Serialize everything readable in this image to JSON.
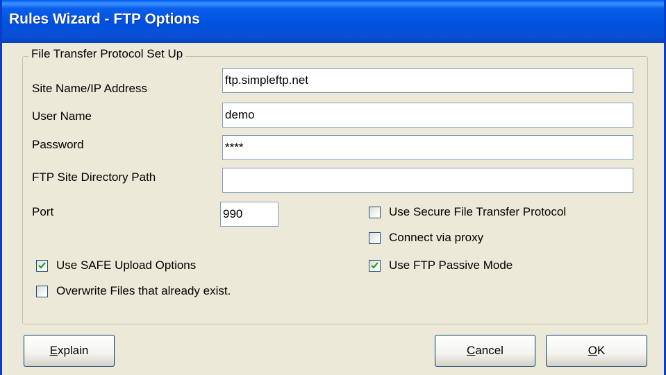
{
  "window": {
    "title": "Rules Wizard - FTP Options"
  },
  "group": {
    "legend": "File Transfer Protocol Set Up"
  },
  "fields": {
    "site_label": "Site Name/IP Address",
    "site_value": "ftp.simpleftp.net",
    "user_label": "User Name",
    "user_value": "demo",
    "password_label": "Password",
    "password_value": "****",
    "path_label": "FTP Site Directory Path",
    "path_value": "",
    "port_label": "Port",
    "port_value": "990"
  },
  "checkboxes": {
    "secure": {
      "label": "Use Secure File Transfer Protocol",
      "checked": false
    },
    "proxy": {
      "label": "Connect via proxy",
      "checked": false
    },
    "safe_upload": {
      "label": "Use SAFE Upload Options",
      "checked": true
    },
    "passive": {
      "label": "Use FTP Passive Mode",
      "checked": true
    },
    "overwrite": {
      "label": "Overwrite Files that already exist.",
      "checked": false
    }
  },
  "buttons": {
    "explain_accel": "E",
    "explain_rest": "xplain",
    "cancel_accel": "C",
    "cancel_rest": "ancel",
    "ok_accel": "O",
    "ok_rest": "K"
  }
}
